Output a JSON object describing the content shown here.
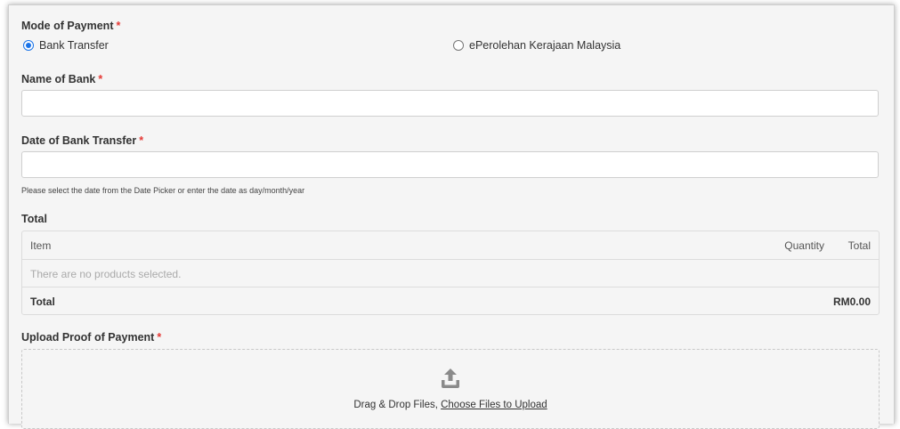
{
  "form": {
    "payment_mode": {
      "label": "Mode of Payment",
      "required_mark": "*",
      "options": [
        {
          "label": "Bank Transfer",
          "selected": true
        },
        {
          "label": "ePerolehan Kerajaan Malaysia",
          "selected": false
        }
      ]
    },
    "bank_name": {
      "label": "Name of Bank",
      "required_mark": "*",
      "value": "",
      "placeholder": ""
    },
    "transfer_date": {
      "label": "Date of Bank Transfer",
      "required_mark": "*",
      "value": "",
      "placeholder": "",
      "help": "Please select the date from the Date Picker or enter the date as day/month/year"
    }
  },
  "total_section": {
    "label": "Total",
    "columns": {
      "item": "Item",
      "quantity": "Quantity",
      "total": "Total"
    },
    "empty_message": "There are no products selected.",
    "footer": {
      "label": "Total",
      "value": "RM0.00"
    }
  },
  "upload": {
    "label": "Upload Proof of Payment",
    "required_mark": "*",
    "icon": "upload-icon",
    "text_prefix": "Drag & Drop Files, ",
    "link_text": "Choose Files to Upload"
  },
  "colors": {
    "accent": "#1a73e8",
    "required": "#e53935",
    "background": "#f5f5f5"
  }
}
